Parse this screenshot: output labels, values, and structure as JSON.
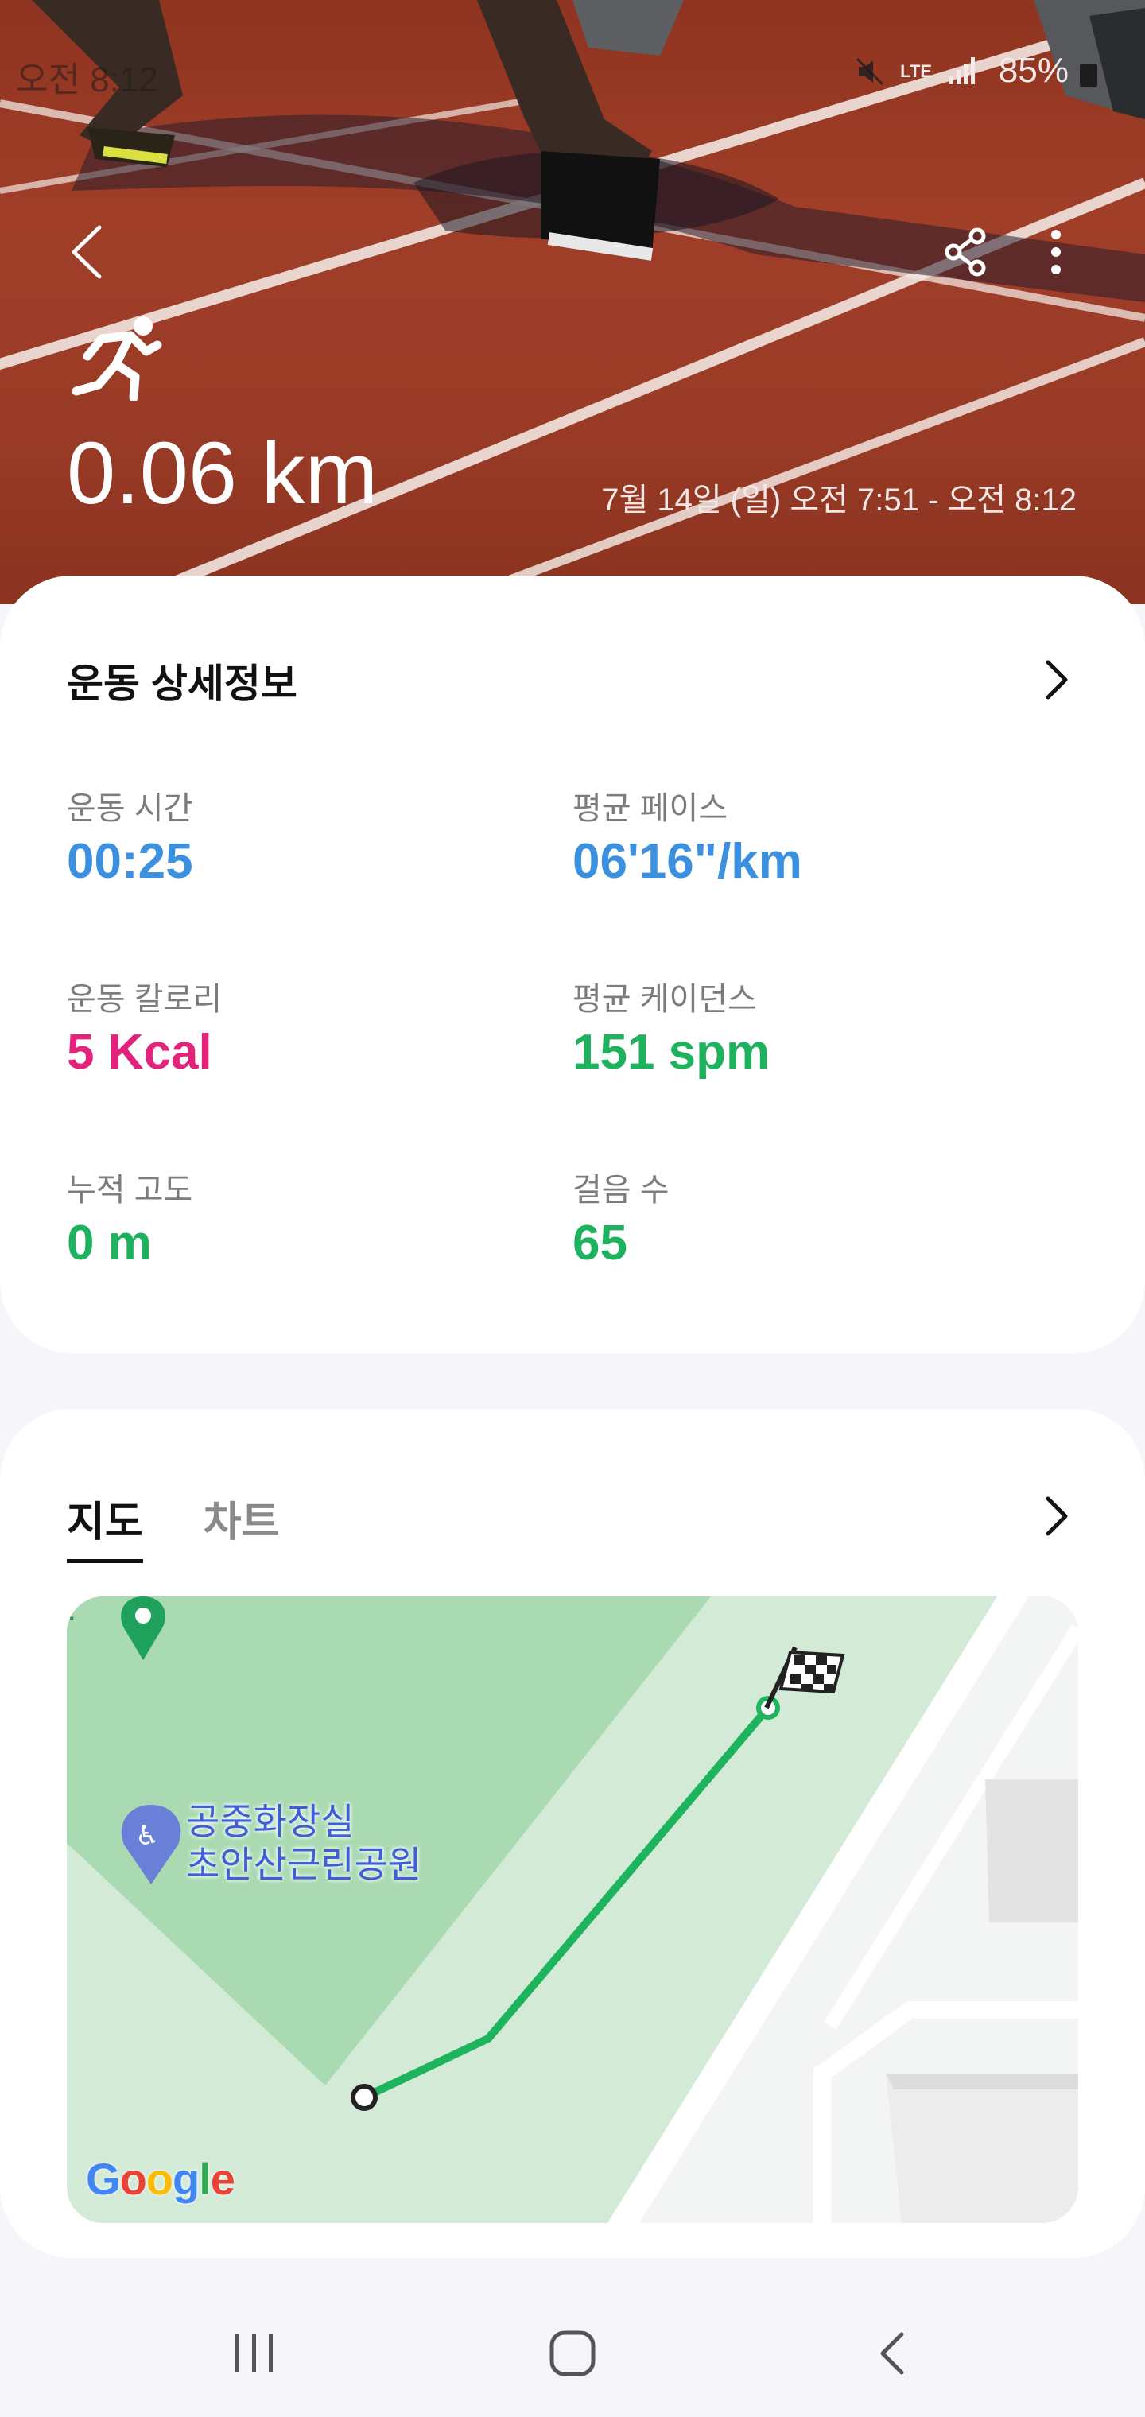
{
  "status_bar": {
    "time": "오전 8:12",
    "network": "LTE",
    "battery": "85%"
  },
  "hero": {
    "distance": "0.06 km",
    "date_range": "7월 14일 (일) 오전 7:51 - 오전 8:12",
    "icons": [
      "back-icon",
      "share-icon",
      "more-options-icon",
      "running-icon"
    ]
  },
  "details": {
    "title": "운동 상세정보",
    "metrics": [
      {
        "label": "운동 시간",
        "value": "00:25",
        "color": "#3c90e0"
      },
      {
        "label": "평균 페이스",
        "value": "06'16\"/km",
        "color": "#3c90e0"
      },
      {
        "label": "운동 칼로리",
        "value": "5 Kcal",
        "color": "#e2237b"
      },
      {
        "label": "평균 케이던스",
        "value": "151 spm",
        "color": "#1fb25e"
      },
      {
        "label": "누적 고도",
        "value": "0 m",
        "color": "#1fb25e"
      },
      {
        "label": "걸음 수",
        "value": "65",
        "color": "#1fb25e"
      }
    ]
  },
  "map_section": {
    "tabs": [
      {
        "label": "지도",
        "active": true
      },
      {
        "label": "차트",
        "active": false
      }
    ],
    "place_label_line1": "공중화장실",
    "place_label_line2": "초안산근린공원",
    "map_logo": "Google",
    "route_color": "#1db45d"
  },
  "colors": {
    "accent_blue": "#3c90e0",
    "accent_pink": "#e2237b",
    "accent_green": "#1fb25e"
  }
}
